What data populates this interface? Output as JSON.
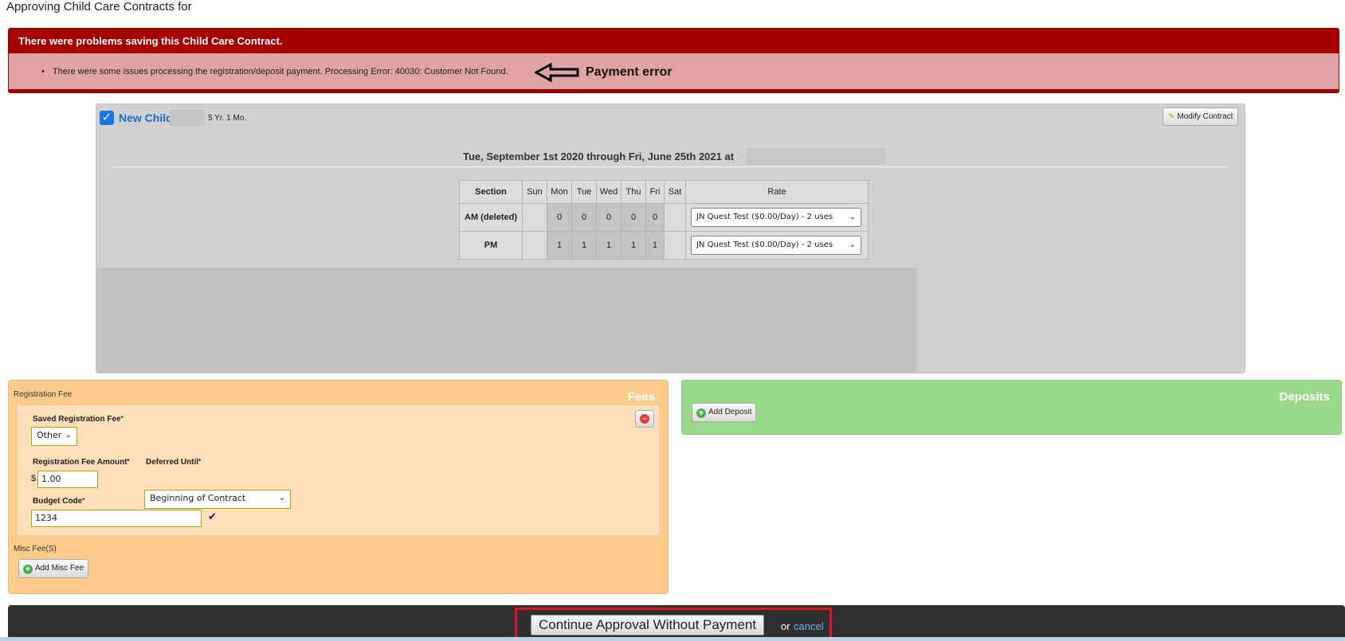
{
  "page": {
    "title": "Approving Child Care Contracts for"
  },
  "error": {
    "heading": "There were problems saving this Child Care Contract.",
    "message": "There were some issues processing the registration/deposit payment. Processing Error: 40030: Customer Not Found.",
    "annotation": "Payment error"
  },
  "child": {
    "name": "New Child",
    "age": "5 Yr. 1 Mo.",
    "checked": true,
    "modify_label": "Modify Contract",
    "date_range": "Tue, September 1st 2020 through Fri, June 25th 2021 at"
  },
  "schedule": {
    "headers": [
      "Section",
      "Sun",
      "Mon",
      "Tue",
      "Wed",
      "Thu",
      "Fri",
      "Sat",
      "Rate"
    ],
    "rows": [
      {
        "section": "AM (deleted)",
        "sun": "",
        "mon": "0",
        "tue": "0",
        "wed": "0",
        "thu": "0",
        "fri": "0",
        "sat": "",
        "rate": "JN Quest Test ($0.00/Day) - 2 uses"
      },
      {
        "section": "PM",
        "sun": "",
        "mon": "1",
        "tue": "1",
        "wed": "1",
        "thu": "1",
        "fri": "1",
        "sat": "",
        "rate": "JN Quest Test ($0.00/Day) - 2 uses"
      }
    ]
  },
  "fees": {
    "title": "Fees",
    "registration_label": "Registration Fee",
    "saved_fee_label": "Saved Registration Fee",
    "saved_fee_value": "Other",
    "amount_label": "Registration Fee Amount",
    "currency": "$",
    "amount_value": "1.00",
    "deferred_label": "Deferred Until",
    "deferred_value": "Beginning of Contract",
    "budget_label": "Budget Code",
    "budget_value": "1234",
    "required_mark": "*",
    "misc_label": "Misc Fee(S)",
    "add_misc_label": "Add Misc Fee"
  },
  "deposits": {
    "title": "Deposits",
    "add_label": "Add Deposit"
  },
  "footer": {
    "continue_label": "Continue Approval Without Payment",
    "or_text": "or",
    "cancel_label": "cancel"
  },
  "icons": {
    "checkbox": "checkbox-checked-icon",
    "modify": "pencil-icon",
    "remove": "minus-circle-icon",
    "add": "plus-circle-icon",
    "arrow": "arrow-left-icon",
    "check": "checkmark-icon"
  },
  "colors": {
    "error_header": "#a80000",
    "error_body": "#e0a3a3",
    "fees_bg": "#fdcc8c",
    "deposits_bg": "#9bd98a",
    "link": "#1a6fc4",
    "highlight": "#e0141e"
  }
}
